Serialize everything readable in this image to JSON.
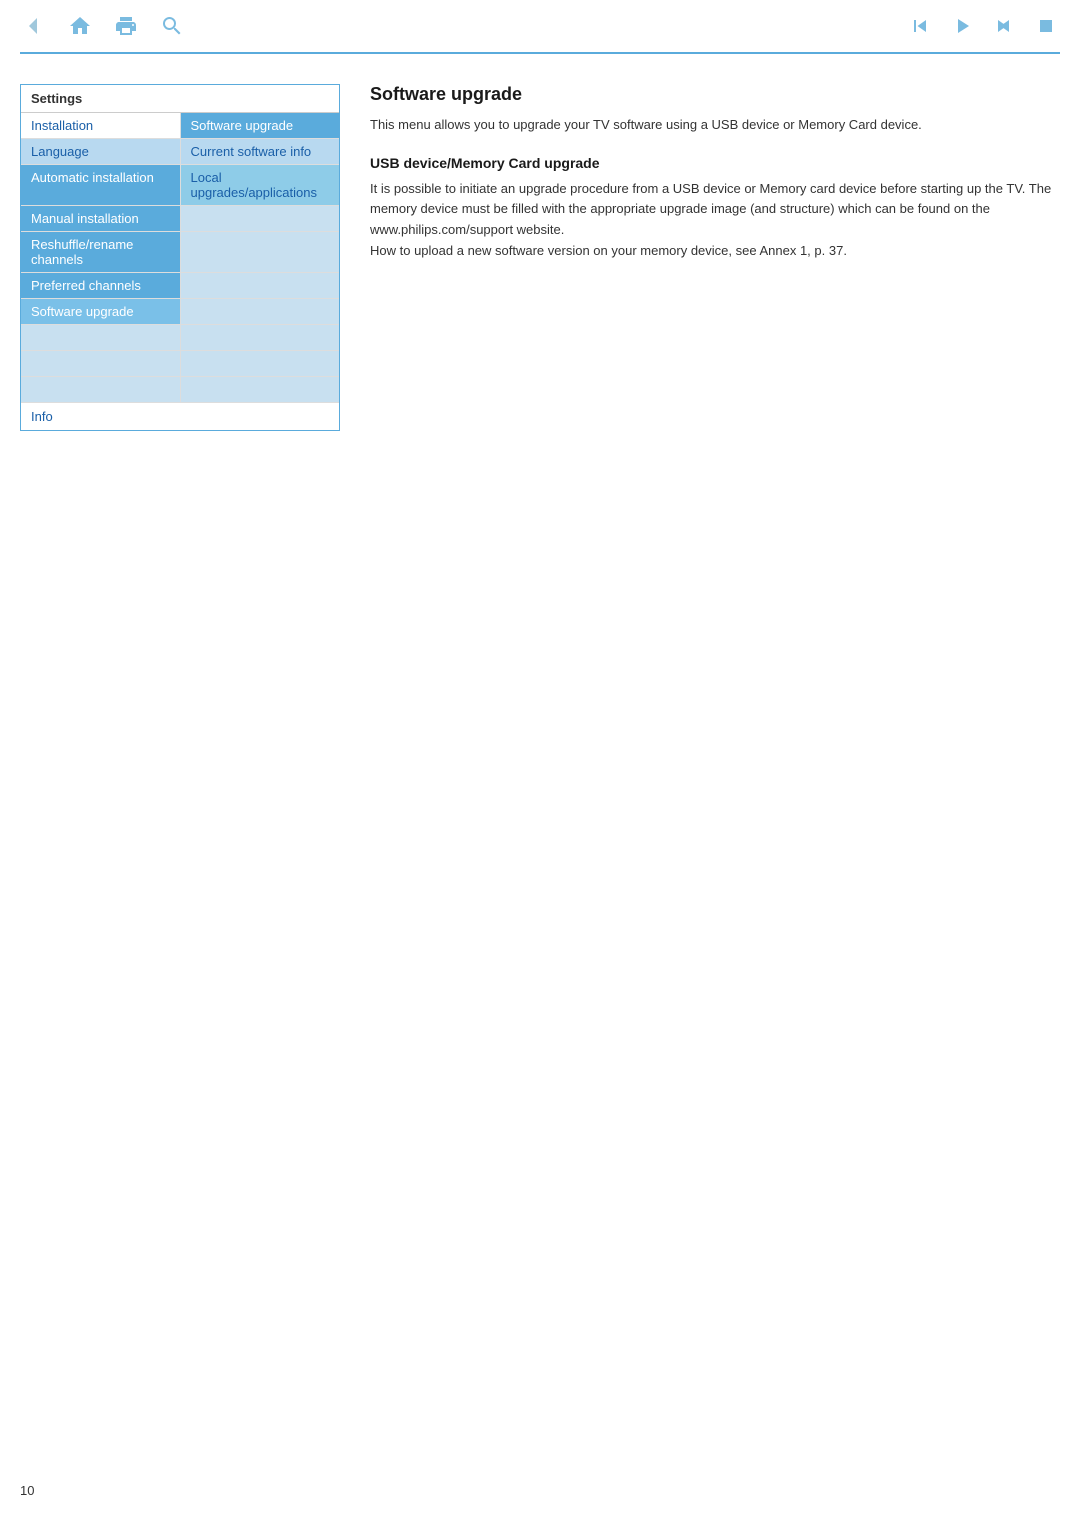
{
  "toolbar": {
    "icons_left": [
      "back-arrow",
      "home",
      "print",
      "search"
    ],
    "icons_right": [
      "skip-back",
      "play",
      "skip-forward",
      "stop"
    ]
  },
  "menu": {
    "header": "Settings",
    "rows": [
      {
        "left": "Installation",
        "left_style": "normal",
        "right": "Software upgrade",
        "right_style": "selected"
      },
      {
        "left": "Language",
        "left_style": "highlight-light",
        "right": "Current software info",
        "right_style": "right-highlight"
      },
      {
        "left": "Automatic installation",
        "left_style": "highlight-blue",
        "right": "Local upgrades/applications",
        "right_style": "right-dark"
      },
      {
        "left": "Manual installation",
        "left_style": "highlight-blue",
        "right": "",
        "right_style": "right-empty"
      },
      {
        "left": "Reshuffle/rename channels",
        "left_style": "highlight-blue",
        "right": "",
        "right_style": "right-empty"
      },
      {
        "left": "Preferred channels",
        "left_style": "highlight-blue",
        "right": "",
        "right_style": "right-empty"
      },
      {
        "left": "Software upgrade",
        "left_style": "highlight-selected",
        "right": "",
        "right_style": "right-empty"
      },
      {
        "left": "",
        "left_style": "empty",
        "right": "",
        "right_style": "right-empty"
      },
      {
        "left": "",
        "left_style": "empty",
        "right": "",
        "right_style": "right-empty"
      },
      {
        "left": "",
        "left_style": "empty",
        "right": "",
        "right_style": "right-empty"
      }
    ],
    "info_label": "Info"
  },
  "content": {
    "title": "Software upgrade",
    "description": "This menu allows you to upgrade your TV software using a USB device or Memory Card device.",
    "section_title": "USB device/Memory Card upgrade",
    "section_desc": "It is possible to initiate an upgrade procedure from a USB device or Memory card device before starting up the TV. The memory device must be filled with the appropriate upgrade image (and structure) which can be found on the www.philips.com/support website.\nHow to upload a new software version on your memory device, see Annex 1, p. 37."
  },
  "page_number": "10"
}
